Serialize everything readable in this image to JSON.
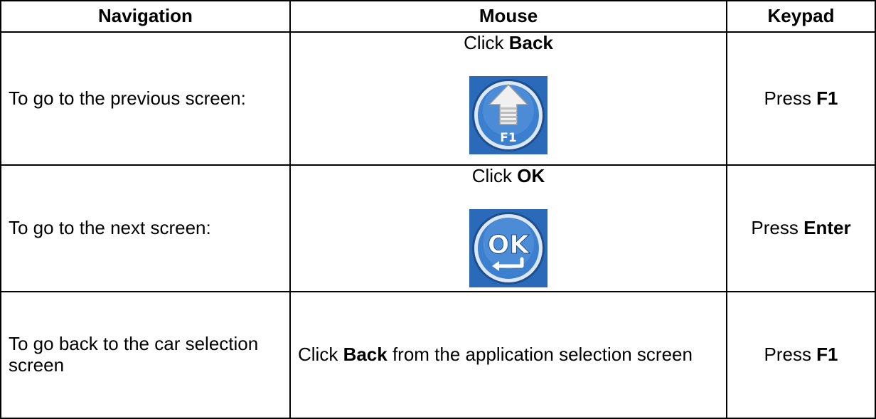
{
  "headers": [
    "Navigation",
    "Mouse",
    "Keypad"
  ],
  "rows": [
    {
      "navigation": "To go to the previous screen:",
      "mouse_prefix": "Click ",
      "mouse_bold": "Back",
      "mouse_suffix": "",
      "mouse_icon": "back-f1-icon",
      "icon_caption": "F1",
      "keypad_prefix": "Press ",
      "keypad_bold": "F1"
    },
    {
      "navigation": "To go to the next screen:",
      "mouse_prefix": "Click ",
      "mouse_bold": "OK",
      "mouse_suffix": "",
      "mouse_icon": "ok-enter-icon",
      "icon_caption": "OK",
      "keypad_prefix": "Press ",
      "keypad_bold": "Enter"
    },
    {
      "navigation": "To go back to the car selection screen",
      "mouse_prefix": "Click ",
      "mouse_bold": "Back",
      "mouse_suffix": " from the application selection screen",
      "keypad_prefix": "Press ",
      "keypad_bold": "F1"
    }
  ],
  "colors": {
    "icon_background": "#2a6ab8",
    "icon_ring": "#dbe7f5",
    "icon_inner": "#3c7fcf",
    "icon_arrow": "#e6e6e6"
  }
}
